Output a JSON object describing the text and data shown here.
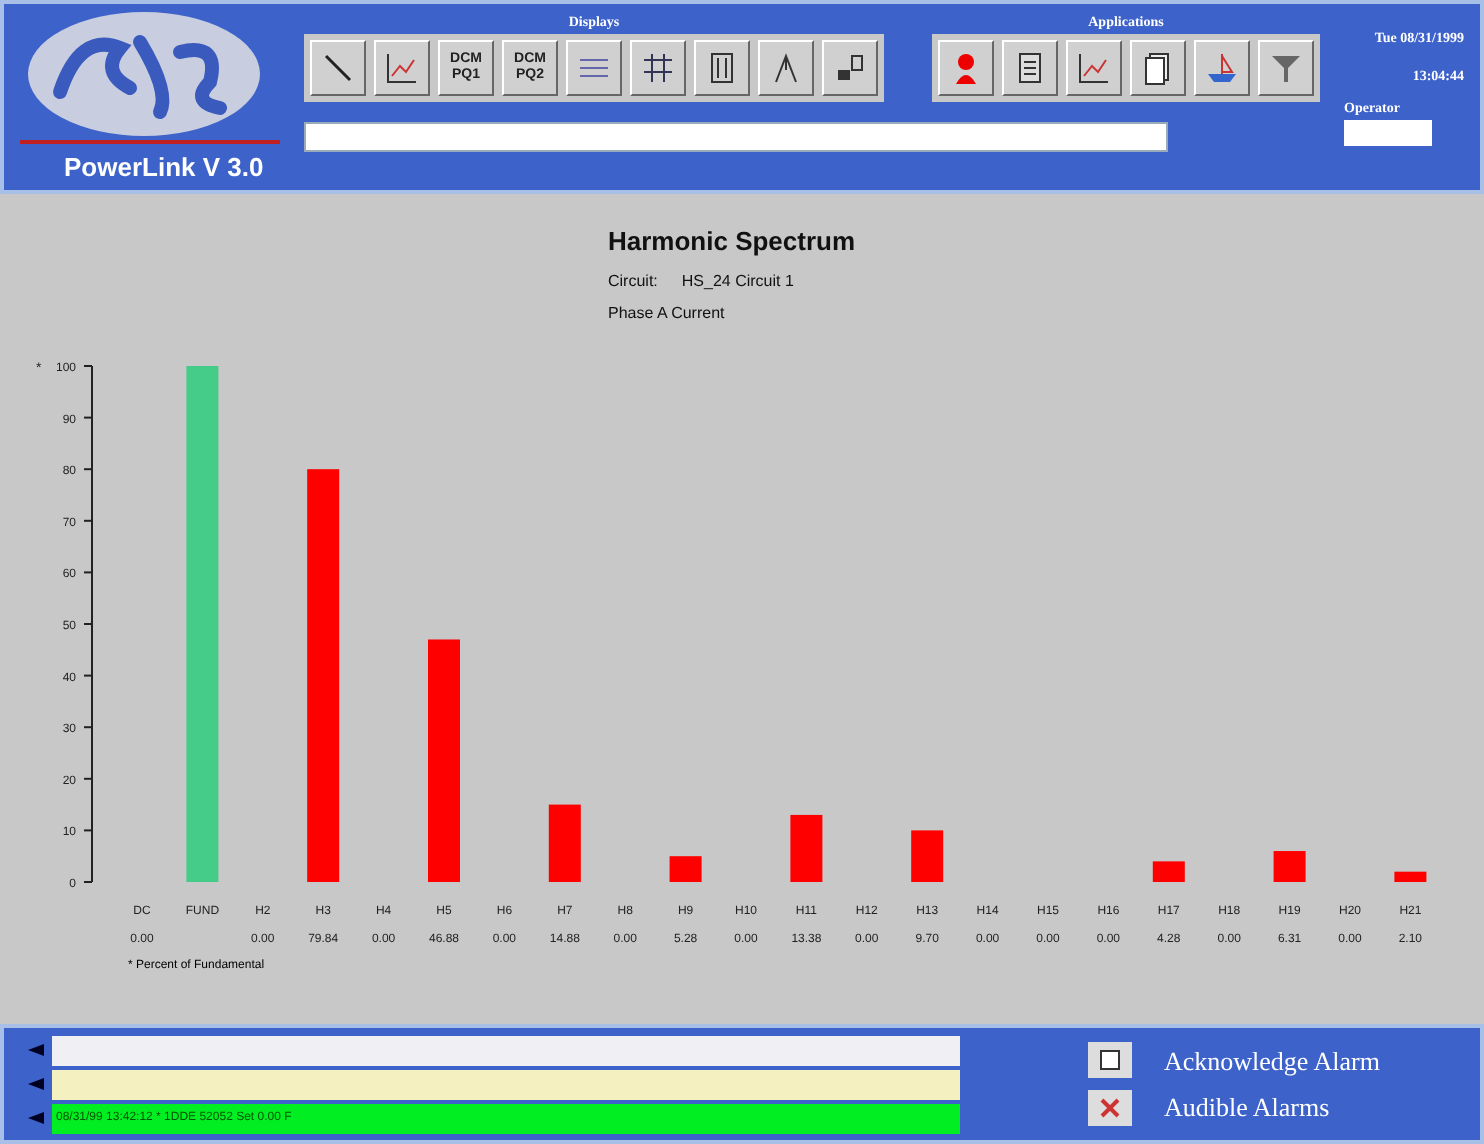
{
  "header": {
    "product": "PowerLink V 3.0",
    "displays_label": "Displays",
    "displays": [
      {
        "kind": "icon"
      },
      {
        "kind": "icon"
      },
      {
        "kind": "text",
        "label": "DCM PQ1"
      },
      {
        "kind": "text",
        "label": "DCM PQ2"
      },
      {
        "kind": "icon"
      },
      {
        "kind": "icon"
      },
      {
        "kind": "icon"
      },
      {
        "kind": "icon"
      },
      {
        "kind": "icon"
      }
    ],
    "applications_label": "Applications",
    "applications": [
      {
        "kind": "icon"
      },
      {
        "kind": "icon"
      },
      {
        "kind": "icon"
      },
      {
        "kind": "icon"
      },
      {
        "kind": "icon"
      },
      {
        "kind": "icon"
      }
    ],
    "date": "Tue 08/31/1999",
    "time": "13:04:44",
    "operator_label": "Operator"
  },
  "spectrum": {
    "title": "Harmonic Spectrum",
    "circuit_label": "Circuit:",
    "circuit": "HS_24 Circuit 1",
    "phase": "Phase A Current",
    "footnote": "* Percent of Fundamental",
    "chart_data": {
      "type": "bar",
      "ylabel": "*",
      "stacked": true,
      "categories": [
        "DC",
        "FUND",
        "H2",
        "H3",
        "H4",
        "H5",
        "H6",
        "H7",
        "H8",
        "H9",
        "H10",
        "H11",
        "H12",
        "H13",
        "H14",
        "H15",
        "H16",
        "H17",
        "H18",
        "H19",
        "H20",
        "H21"
      ],
      "series": [
        {
          "color": "#44cc88",
          "values": [
            null,
            100,
            null,
            null,
            null,
            null,
            null,
            null,
            null,
            null,
            null,
            null,
            null,
            null,
            null,
            null,
            null,
            null,
            null,
            null,
            null,
            null
          ]
        },
        {
          "color": "#ff0000",
          "values": [
            0,
            null,
            0,
            80,
            0,
            47,
            0,
            15,
            0,
            5,
            0,
            13,
            0,
            10,
            0,
            0,
            0,
            4,
            0,
            6,
            0,
            2
          ]
        }
      ],
      "ylim": [
        0,
        100
      ],
      "yticks": [
        0,
        10,
        20,
        30,
        40,
        50,
        60,
        70,
        80,
        90,
        100
      ],
      "value_labels": [
        "0.00",
        null,
        "0.00",
        "79.84",
        "0.00",
        "46.88",
        "0.00",
        "14.88",
        "0.00",
        "5.28",
        "0.00",
        "13.38",
        "0.00",
        "9.70",
        "0.00",
        "0.00",
        "0.00",
        "4.28",
        "0.00",
        "6.31",
        "0.00",
        "2.10"
      ]
    }
  },
  "alarms": {
    "lines": [
      {
        "color": "#f0f0f4"
      },
      {
        "color": "#f4f0c0"
      },
      {
        "color": "#00ee22",
        "text": "08/31/99 13:42:12  *  1DDE 52052 Set 0.00 F"
      }
    ],
    "buttons": [
      {
        "kind": "acknowledge",
        "label": "Acknowledge Alarm"
      },
      {
        "kind": "audible",
        "label": "Audible Alarms"
      }
    ]
  }
}
